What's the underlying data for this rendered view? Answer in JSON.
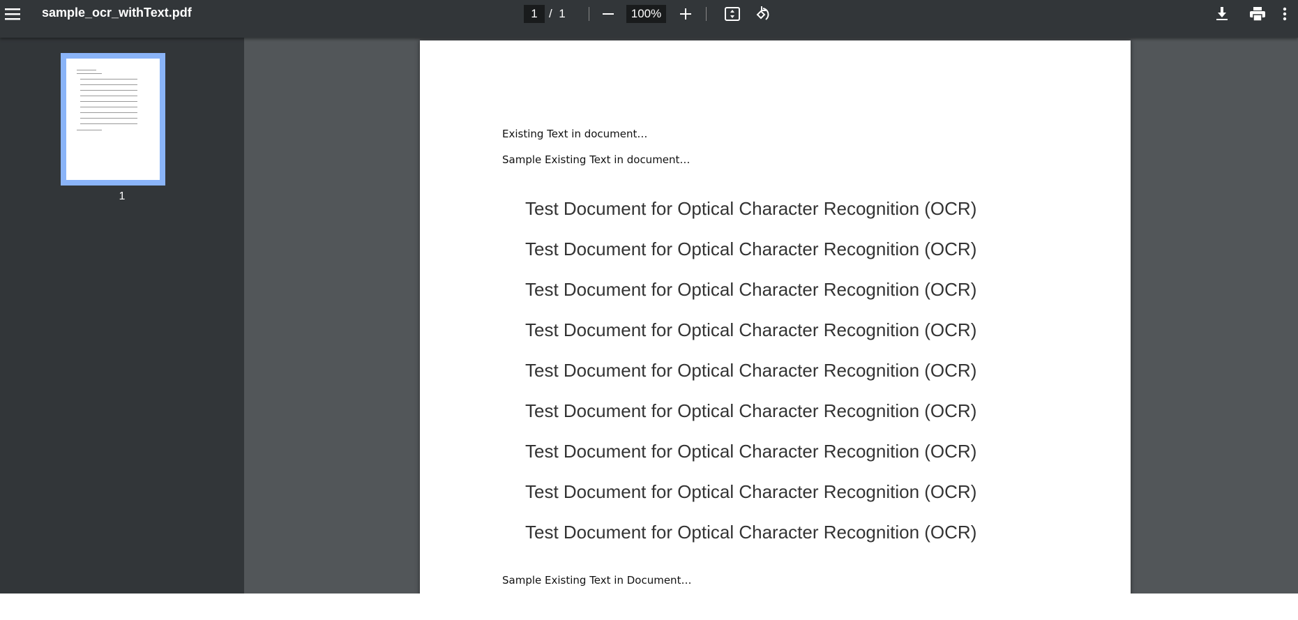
{
  "toolbar": {
    "title": "sample_ocr_withText.pdf",
    "current_page": "1",
    "page_sep": "/",
    "total_pages": "1",
    "zoom": "100%"
  },
  "sidebar": {
    "thumbnail_label": "1"
  },
  "document": {
    "line1": "Existing Text in document…",
    "line2": "Sample Existing Text in document…",
    "ocr_lines": [
      "Test Document for Optical Character Recognition (OCR)",
      "Test Document for Optical Character Recognition (OCR)",
      "Test Document for Optical Character Recognition (OCR)",
      "Test Document for Optical Character Recognition (OCR)",
      "Test Document for Optical Character Recognition (OCR)",
      "Test Document for Optical Character Recognition (OCR)",
      "Test Document for Optical Character Recognition (OCR)",
      "Test Document for Optical Character Recognition (OCR)",
      "Test Document for Optical Character Recognition (OCR)"
    ],
    "footer_line": "Sample Existing Text in Document…"
  }
}
